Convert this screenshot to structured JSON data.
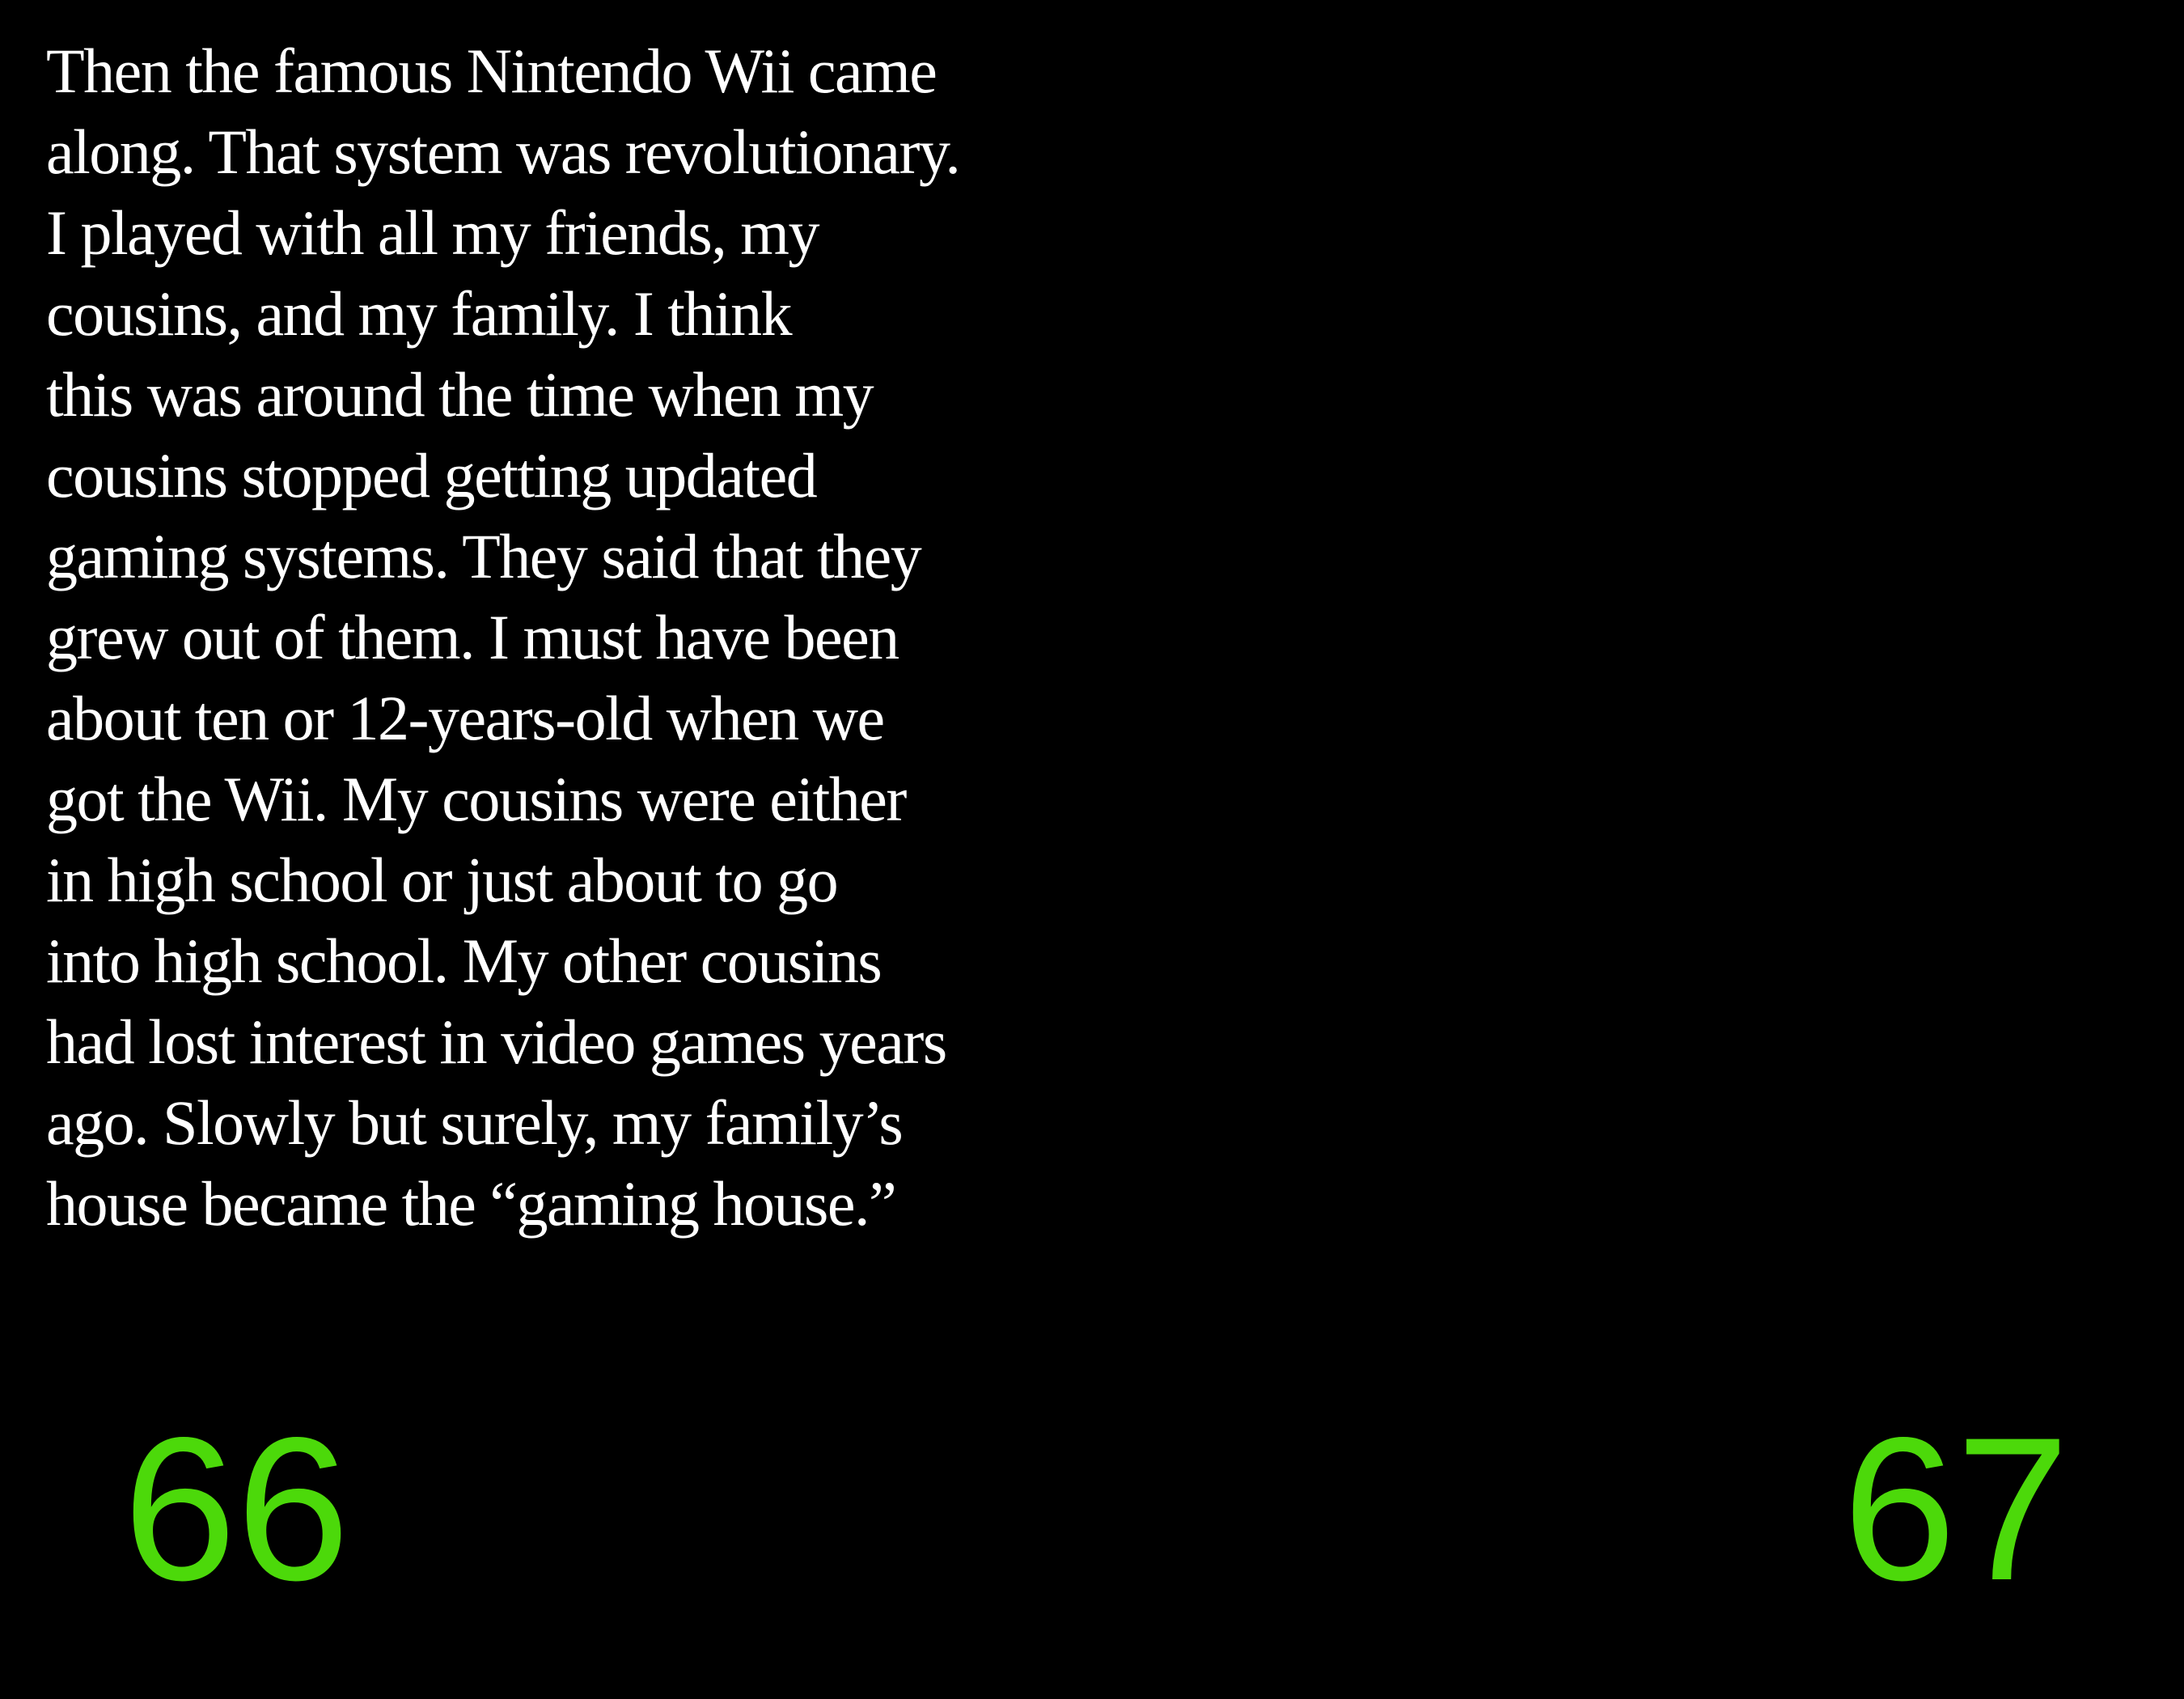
{
  "text": {
    "lines": [
      "Then the famous Nintendo Wii came",
      "along. That system was revolutionary.",
      "I played with all my friends, my",
      "cousins, and my family. I think",
      "this was around the time when my",
      "cousins stopped getting updated",
      "gaming systems. They said that they",
      "grew out of them. I must have been",
      "about ten or 12-years-old when we",
      "got the Wii. My cousins were either",
      "in high school or just about to go",
      "into high school. My other cousins",
      "had lost interest in video games years",
      "ago. Slowly but surely, my family’s",
      "house became the “gaming house.”"
    ]
  },
  "page_numbers": {
    "left": "66",
    "right": "67"
  },
  "colors": {
    "background": "#000000",
    "text": "#ffffff",
    "page_number": "#4cd90a"
  }
}
